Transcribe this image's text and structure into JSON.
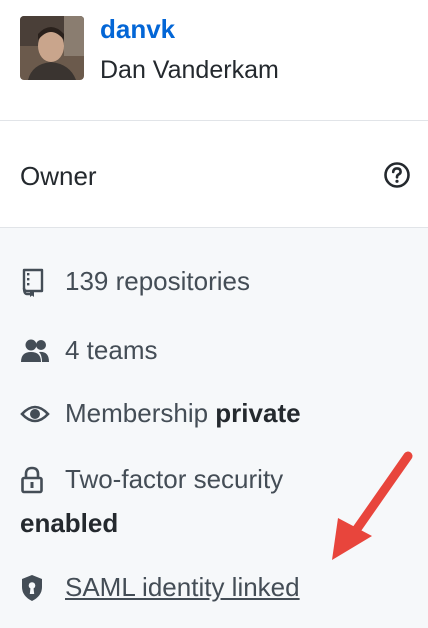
{
  "user": {
    "username": "danvk",
    "full_name": "Dan Vanderkam"
  },
  "role": {
    "label": "Owner",
    "help_icon": "question-circle-icon"
  },
  "details": {
    "repositories": {
      "icon": "repo-icon",
      "text": "139 repositories"
    },
    "teams": {
      "icon": "people-icon",
      "text": "4 teams"
    },
    "membership": {
      "icon": "eye-icon",
      "prefix": "Membership",
      "value": "private"
    },
    "two_factor": {
      "icon": "lock-icon",
      "prefix": "Two-factor security",
      "value": "enabled"
    },
    "saml": {
      "icon": "shield-lock-icon",
      "text": "SAML identity linked"
    }
  },
  "annotation": {
    "arrow_color": "#e8453c"
  },
  "colors": {
    "link": "#0366d6",
    "muted": "#444d56",
    "panel": "#f6f8fa"
  }
}
